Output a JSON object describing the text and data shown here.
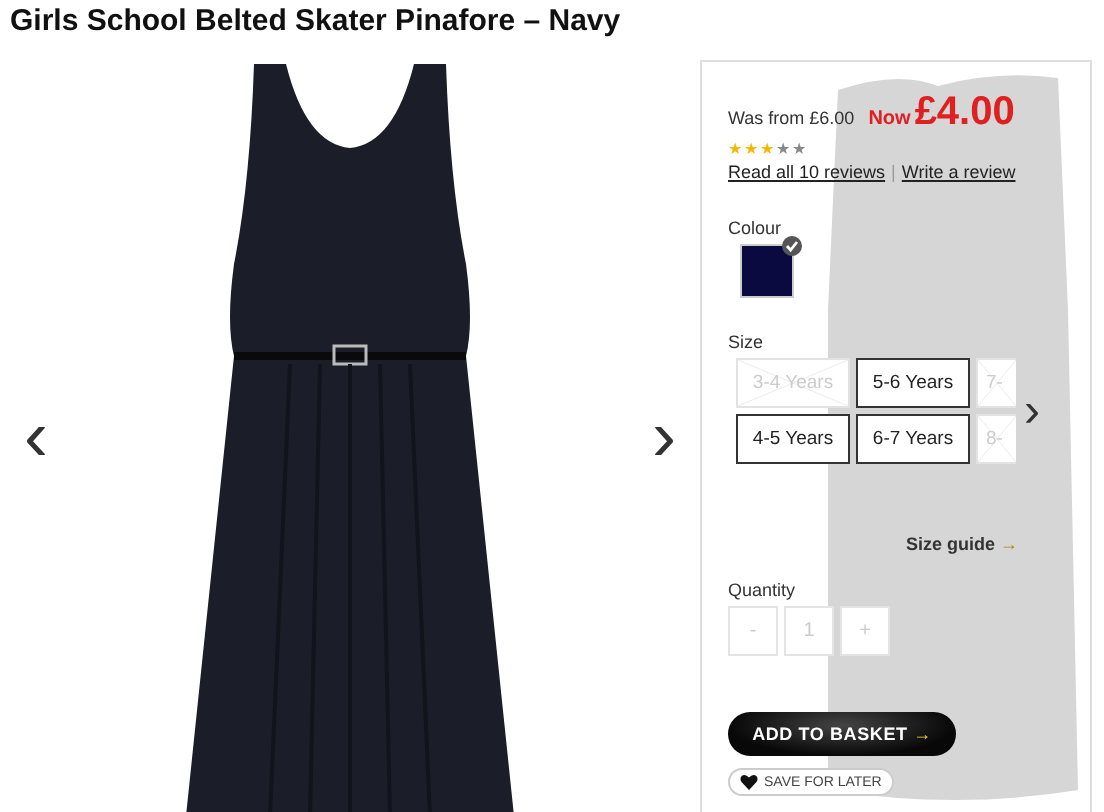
{
  "title": "Girls School Belted Skater Pinafore – Navy",
  "gallery": {
    "prev": "‹",
    "next": "›"
  },
  "price": {
    "was": "Was from £6.00",
    "now_label": "Now",
    "now": "£4.00"
  },
  "rating": {
    "stars": 3
  },
  "reviews": {
    "read": "Read all 10 reviews",
    "separator": "|",
    "write": "Write a review"
  },
  "colour": {
    "label": "Colour",
    "swatches": [
      {
        "color": "#0a0a40",
        "selected": true
      }
    ]
  },
  "size": {
    "label": "Size",
    "options": [
      {
        "label": "3-4 Years",
        "available": false
      },
      {
        "label": "5-6 Years",
        "available": true
      },
      {
        "label": "7-",
        "available": false
      },
      {
        "label": "4-5 Years",
        "available": true
      },
      {
        "label": "6-7 Years",
        "available": true
      },
      {
        "label": "8-",
        "available": false
      }
    ],
    "next": "›",
    "guide": "Size guide",
    "guide_arrow": "→"
  },
  "quantity": {
    "label": "Quantity",
    "minus": "-",
    "value": "1",
    "plus": "+"
  },
  "add_to_basket": {
    "label": "ADD TO BASKET",
    "arrow": "→"
  },
  "save_for_later": "SAVE FOR LATER"
}
